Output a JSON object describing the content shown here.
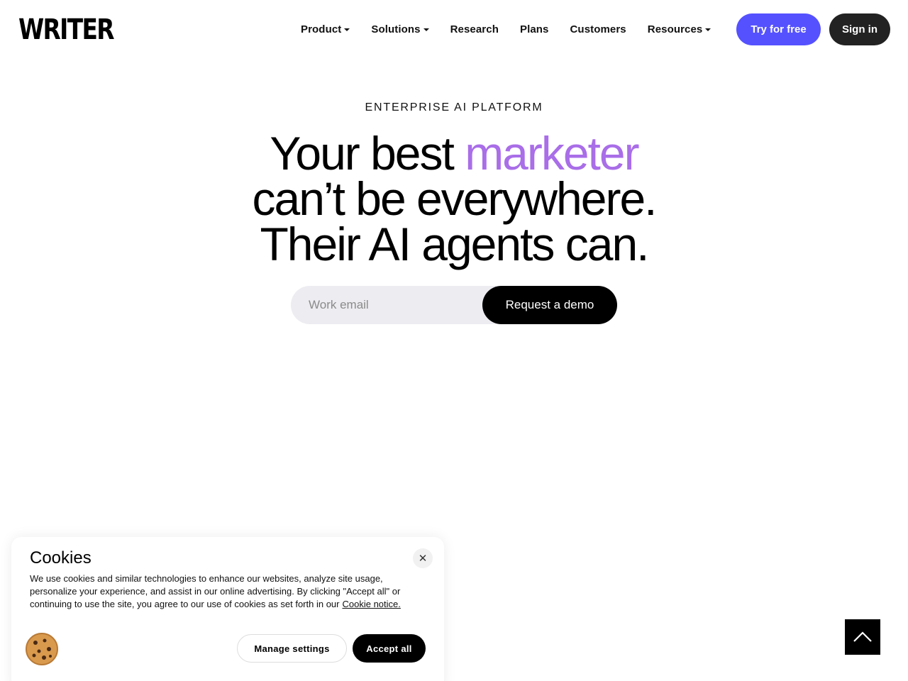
{
  "header": {
    "logo": "WRITER",
    "nav": [
      {
        "label": "Product",
        "dropdown": true
      },
      {
        "label": "Solutions",
        "dropdown": true
      },
      {
        "label": "Research",
        "dropdown": false
      },
      {
        "label": "Plans",
        "dropdown": false
      },
      {
        "label": "Customers",
        "dropdown": false
      },
      {
        "label": "Resources",
        "dropdown": true
      }
    ],
    "try_label": "Try for free",
    "signin_label": "Sign in"
  },
  "hero": {
    "eyebrow": "ENTERPRISE AI PLATFORM",
    "line1_prefix": "Your best ",
    "line1_accent": "marketer",
    "line2": "can’t be everywhere.",
    "line3": "Their AI agents can.",
    "email_placeholder": "Work email",
    "demo_label": "Request a demo"
  },
  "cookie": {
    "title": "Cookies",
    "close_glyph": "✕",
    "body": "We use cookies and similar technologies to enhance our websites, analyze site usage, personalize your experience, and assist in our online advertising. By clicking \"Accept all\" or continuing to use the site, you agree to our use of cookies as set forth in our",
    "link_label": "Cookie notice.",
    "manage_label": "Manage settings",
    "accept_label": "Accept all"
  },
  "colors": {
    "accent_purple": "#a96ee8",
    "try_button": "#5551ff",
    "signin_button": "#222222"
  },
  "icons": {
    "caret": "caret-down-icon",
    "close": "close-icon",
    "cookie": "cookie-icon",
    "scroll_top": "chevron-up-icon"
  }
}
